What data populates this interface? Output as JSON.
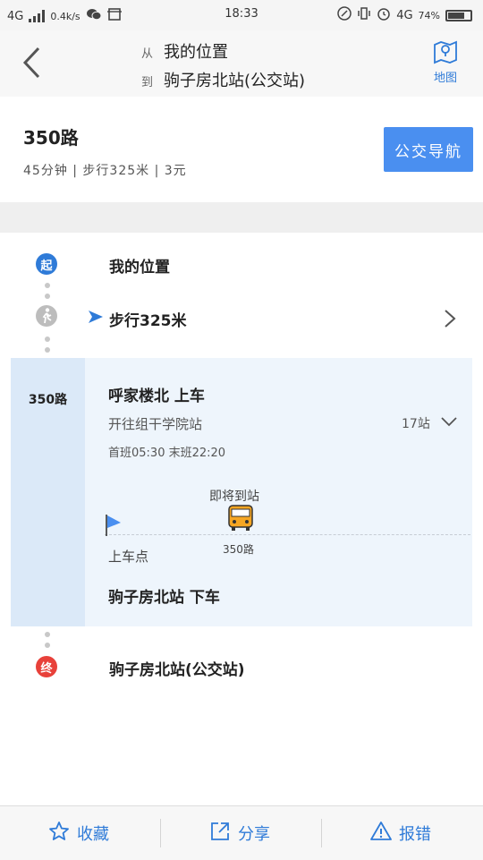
{
  "status_bar": {
    "network": "4G",
    "speed": "0.4k/s",
    "time": "18:33",
    "network2": "4G",
    "battery": "74%"
  },
  "header": {
    "from_prefix": "从",
    "from": "我的位置",
    "to_prefix": "到",
    "to": "驹子房北站(公交站)",
    "map_label": "地图"
  },
  "summary": {
    "route_name": "350路",
    "meta": "45分钟 | 步行325米 | 3元",
    "nav_button": "公交导航"
  },
  "steps": {
    "start_badge": "起",
    "start_label": "我的位置",
    "walk_label": "步行325米",
    "bus_route": "350路",
    "board_stop": "呼家楼北 上车",
    "direction": "开往组干学院站",
    "stops": "17站",
    "schedule": "首班05:30 末班22:20",
    "arriving": "即将到站",
    "bus_tag": "350路",
    "board_point": "上车点",
    "alight_stop": "驹子房北站 下车",
    "end_badge": "终",
    "end_label": "驹子房北站(公交站)"
  },
  "bottom_bar": {
    "favorite": "收藏",
    "share": "分享",
    "report": "报错"
  },
  "colors": {
    "accent": "#4a8ff0",
    "start": "#2f7bd8",
    "end": "#e8413a"
  }
}
